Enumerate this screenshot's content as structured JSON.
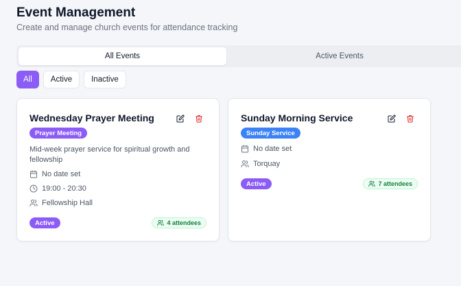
{
  "header": {
    "title": "Event Management",
    "subtitle": "Create and manage church events for attendance tracking"
  },
  "tabs": [
    {
      "label": "All Events",
      "active": true
    },
    {
      "label": "Active Events",
      "active": false
    }
  ],
  "filters": [
    {
      "label": "All",
      "selected": true
    },
    {
      "label": "Active",
      "selected": false
    },
    {
      "label": "Inactive",
      "selected": false
    }
  ],
  "events": [
    {
      "title": "Wednesday Prayer Meeting",
      "type": "Prayer Meeting",
      "type_color": "#8b5cf6",
      "description": "Mid-week prayer service for spiritual growth and fellowship",
      "date": "No date set",
      "time": "19:00 - 20:30",
      "location": "Fellowship Hall",
      "status": "Active",
      "attendees": "4 attendees"
    },
    {
      "title": "Sunday Morning Service",
      "type": "Sunday Service",
      "type_color": "#3b82f6",
      "date": "No date set",
      "location": "Torquay",
      "status": "Active",
      "attendees": "7 attendees"
    }
  ],
  "colors": {
    "accent": "#8b5cf6",
    "danger": "#dc2626",
    "success": "#15803d"
  }
}
